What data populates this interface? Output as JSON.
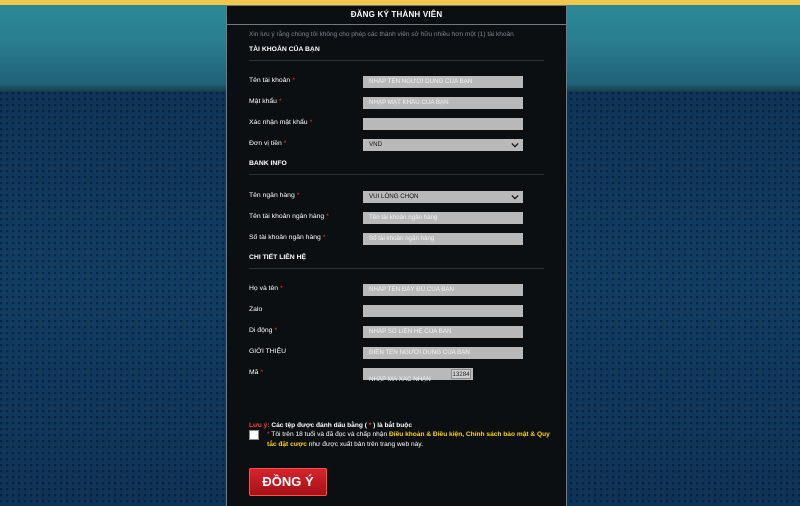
{
  "panel": {
    "title": "ĐĂNG KÝ THÀNH VIÊN",
    "notice": "Xin lưu ý rằng chúng tôi không cho phép các thành viên sở hữu nhiều hơn một (1) tài khoản"
  },
  "sections": {
    "account": "TÀI KHOẢN CỦA BẠN",
    "bank": "BANK INFO",
    "contact": "CHI TIẾT LIÊN HỆ"
  },
  "account": {
    "username_label": "Tên tài khoản",
    "username_placeholder": "NHẬP TÊN NGƯỜI DÙNG CỦA BẠN",
    "password_label": "Mật khẩu",
    "password_placeholder": "NHẬP MẬT KHẨU CỦA BẠN",
    "confirm_password_label": "Xác nhận mật khẩu",
    "currency_label": "Đơn vị tiền",
    "currency_value": "VND"
  },
  "bank": {
    "bank_name_label": "Tên ngân hàng",
    "bank_name_value": "VUI LÒNG CHỌN",
    "account_name_label": "Tên tài khoản ngân hàng",
    "account_name_placeholder": "Tên tài khoản ngân hàng",
    "account_number_label": "Số tài khoản ngân hàng",
    "account_number_placeholder": "Số tài khoản ngân hàng"
  },
  "contact": {
    "fullname_label": "Họ và tên",
    "fullname_placeholder": "NHẬP TÊN ĐẦY ĐỦ CỦA BẠN",
    "zalo_label": "Zalo",
    "mobile_label": "Di động",
    "mobile_placeholder": "NHẬP SỐ LIÊN HỆ CỦA BẠN",
    "referral_label": "GIỚI THIỆU",
    "referral_placeholder": "ĐIỀN TÊN NGƯỜI DÙNG CỦA BẠN",
    "code_label": "Mã",
    "code_placeholder": "NHẬP MÃ XÁC NHẬN",
    "captcha_code": "13284"
  },
  "footer": {
    "note_prefix": "Lưu ý:",
    "note_text": "Các tệp được đánh dấu bằng (",
    "note_star": " * ",
    "note_suffix": ") là bắt buộc",
    "agree_star": "*",
    "agree_text_1": " Tôi trên 18 tuổi và đã đọc và chấp nhận ",
    "agree_terms": "Điều khoản & Điều kiện, Chính sách bảo mật & Quy tắc đặt cược",
    "agree_text_2": " như được xuất bản trên trang web này.",
    "submit_label": "ĐỒNG Ý"
  },
  "colors": {
    "accent_red": "#d4242a",
    "link_yellow": "#ffd400",
    "required_red": "#ff3b3b",
    "panel_bg": "#0b0f12"
  },
  "icons": {
    "select_arrow": "chevron-down-icon"
  }
}
